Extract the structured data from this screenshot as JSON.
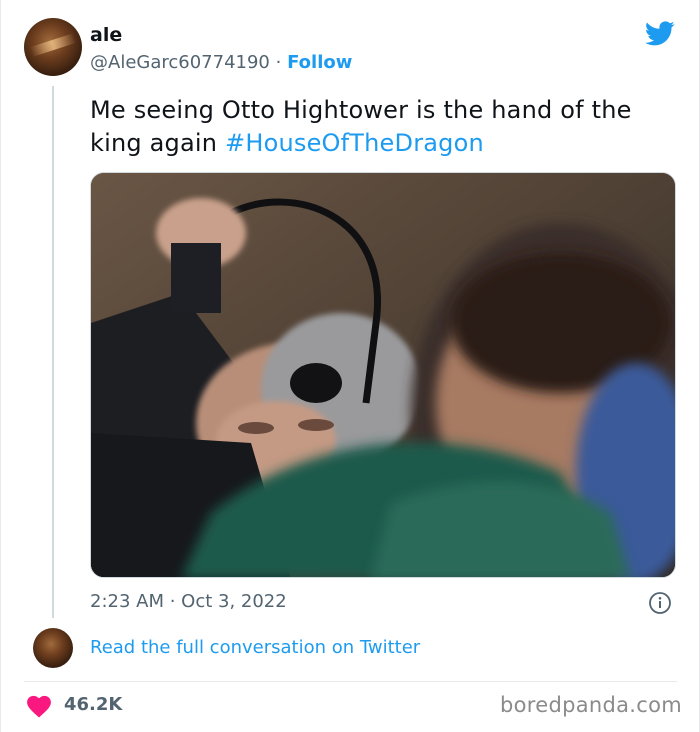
{
  "tweet": {
    "author_name": "ale",
    "handle": "@AleGarc60774190",
    "separator": "·",
    "follow_label": "Follow",
    "text": "Me seeing Otto Hightower is the hand of the king again",
    "hashtag": "#HouseOfTheDragon",
    "timestamp": "2:23 AM · Oct 3, 2022",
    "read_conversation_label": "Read the full conversation on Twitter",
    "like_count": "46.2K"
  },
  "watermark": "boredpanda.com",
  "icons": {
    "brand": "twitter-bird-icon",
    "info": "info-icon",
    "like": "heart-icon"
  },
  "colors": {
    "accent": "#1d9bf0",
    "heart": "#f91880",
    "secondary_text": "#536471",
    "line": "#cfd9de"
  }
}
